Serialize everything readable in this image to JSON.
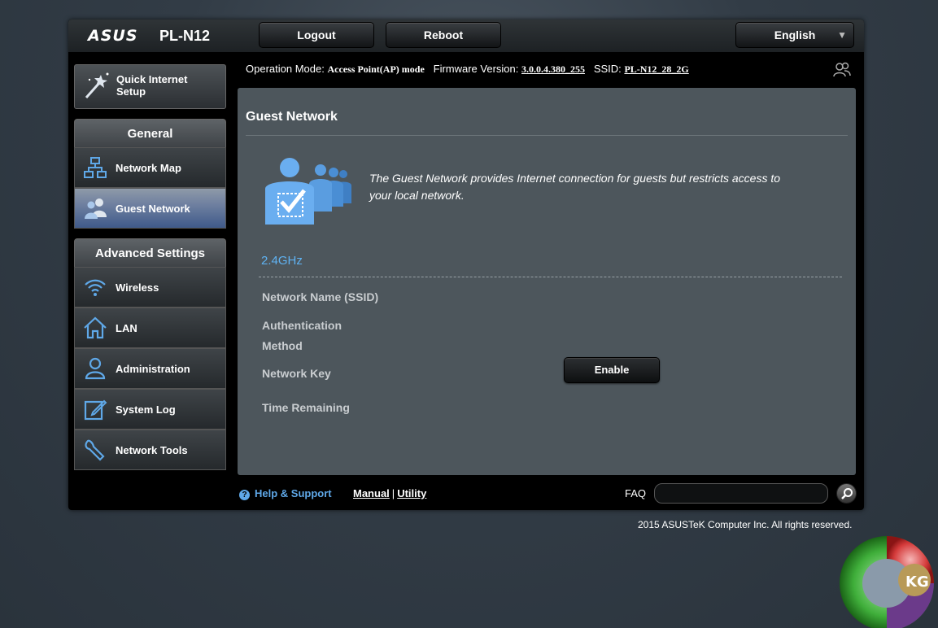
{
  "header": {
    "brand": "ASUS",
    "model": "PL-N12",
    "logout_label": "Logout",
    "reboot_label": "Reboot",
    "language": "English"
  },
  "status": {
    "operation_mode_label": "Operation Mode:",
    "operation_mode_value": "Access Point(AP) mode",
    "firmware_label": "Firmware Version:",
    "firmware_value": "3.0.0.4.380_255",
    "ssid_label": "SSID:",
    "ssid_value": "PL-N12_28_2G"
  },
  "sidebar": {
    "qis_line1": "Quick Internet",
    "qis_line2": "Setup",
    "general_header": "General",
    "general_items": [
      {
        "label": "Network Map",
        "icon": "network-map-icon"
      },
      {
        "label": "Guest Network",
        "icon": "guest-network-icon"
      }
    ],
    "advanced_header": "Advanced Settings",
    "advanced_items": [
      {
        "label": "Wireless",
        "icon": "wifi-icon"
      },
      {
        "label": "LAN",
        "icon": "home-icon"
      },
      {
        "label": "Administration",
        "icon": "admin-user-icon"
      },
      {
        "label": "System Log",
        "icon": "system-log-icon"
      },
      {
        "label": "Network Tools",
        "icon": "wrench-icon"
      }
    ]
  },
  "main": {
    "title": "Guest Network",
    "intro": "The Guest Network provides Internet connection for guests but restricts access to your local network.",
    "band": "2.4GHz",
    "fields": {
      "ssid": "Network Name (SSID)",
      "auth_line1": "Authentication",
      "auth_line2": "Method",
      "key": "Network Key",
      "time": "Time Remaining"
    },
    "enable_label": "Enable"
  },
  "footer": {
    "help": "Help & Support",
    "manual": "Manual",
    "utility": "Utility",
    "separator": "|",
    "faq": "FAQ",
    "faq_value": ""
  },
  "copyright": "2015 ASUSTeK Computer Inc. All rights reserved.",
  "colors": {
    "accent_blue": "#5fb2f2",
    "active_item": "#6f80a0",
    "content_bg": "#4d565c"
  }
}
